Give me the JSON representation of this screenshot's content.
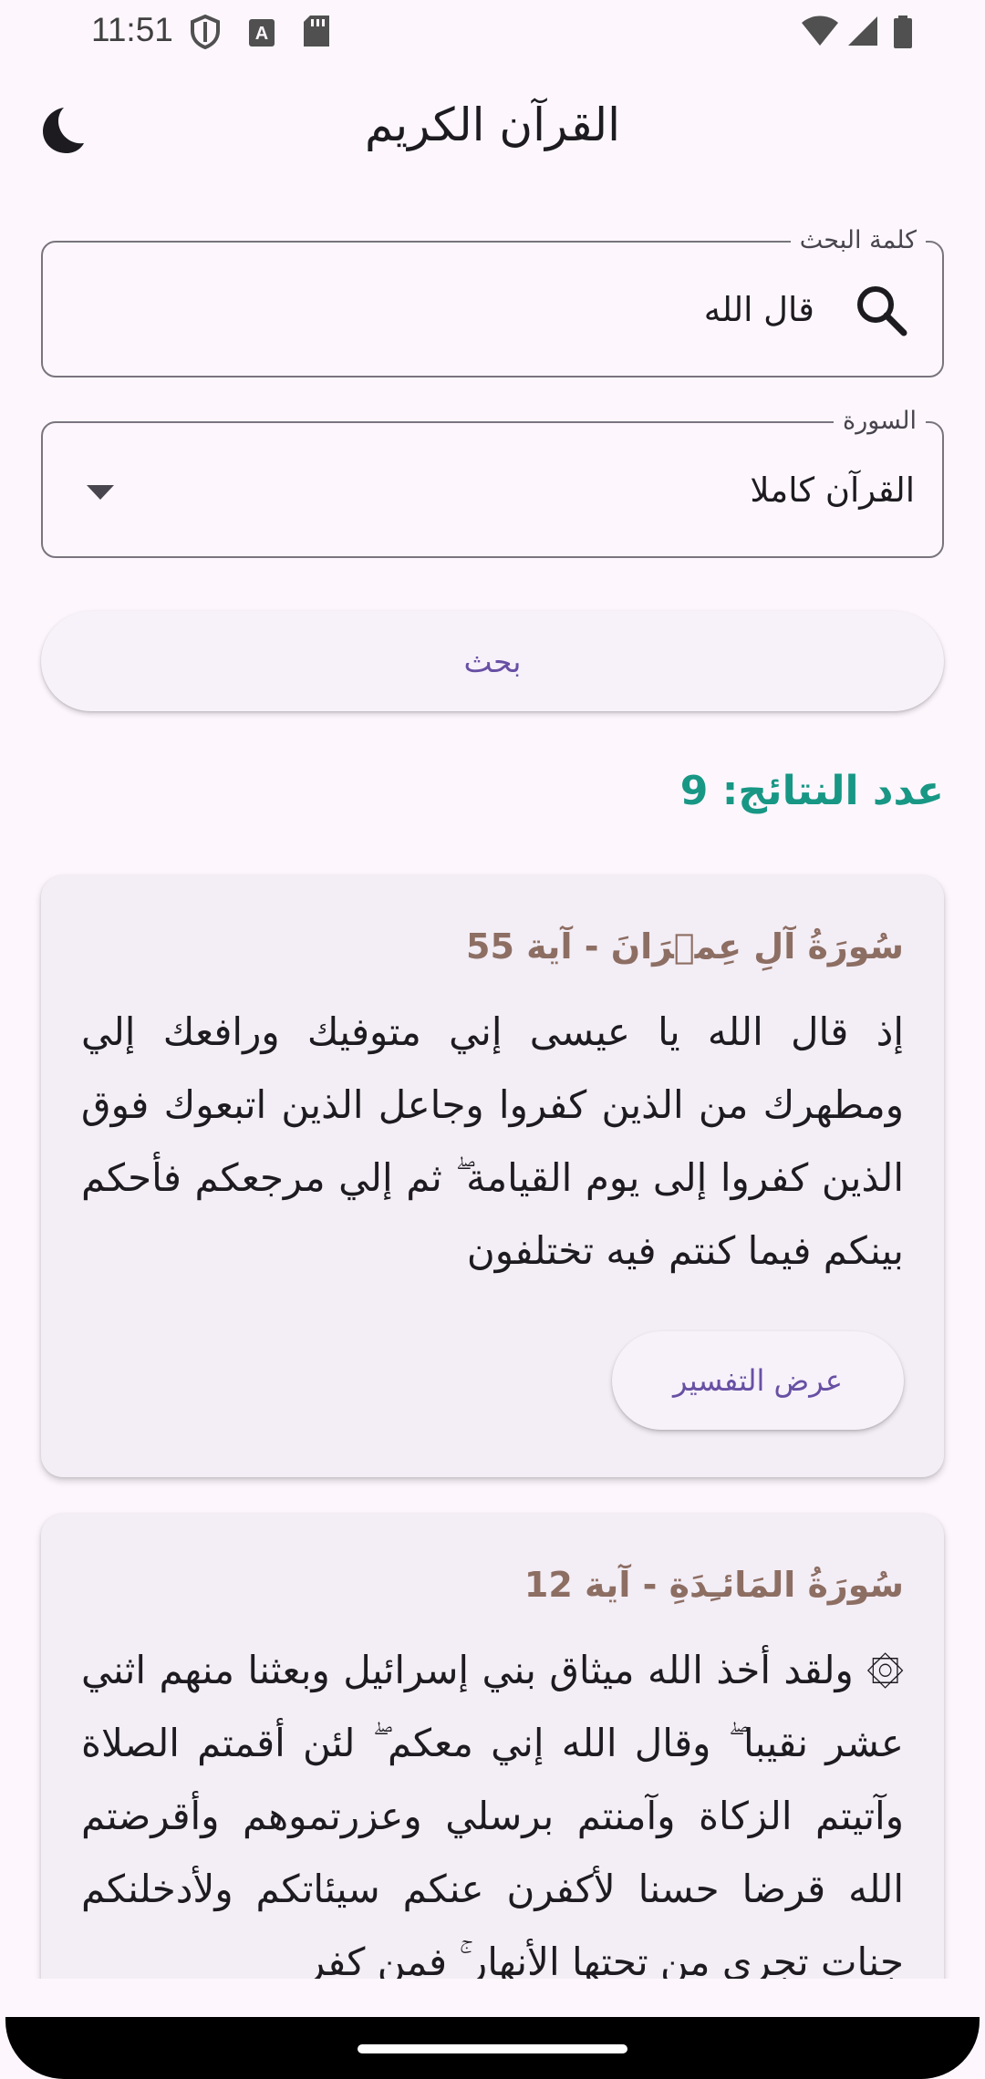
{
  "status_bar": {
    "time": "11:51"
  },
  "app_bar": {
    "title": "القرآن الكريم",
    "theme_icon": "moon-icon"
  },
  "search": {
    "label": "كلمة البحث",
    "value": "قال الله",
    "icon": "search-icon"
  },
  "surah_select": {
    "label": "السورة",
    "value": "القرآن كاملا",
    "icon": "dropdown-arrow-icon"
  },
  "search_button": {
    "label": "بحث"
  },
  "results": {
    "count_text": "عدد النتائج: 9",
    "items": [
      {
        "title": "سُورَةُ آلِ عِمۡرَانَ - آية 55",
        "text": "إذ قال الله يا عيسى إني متوفيك ورافعك إلي ومطهرك من الذين كفروا وجاعل الذين اتبعوك فوق الذين كفروا إلى يوم القيامة ۖ ثم إلي مرجعكم فأحكم بينكم فيما كنتم فيه تختلفون",
        "button_label": "عرض التفسير"
      },
      {
        "title": "سُورَةُ المَائـِدَةِ - آية 12",
        "text": "۞ ولقد أخذ الله ميثاق بني إسرائيل وبعثنا منهم اثني عشر نقيبا ۖ وقال الله إني معكم ۖ لئن أقمتم الصلاة وآتيتم الزكاة وآمنتم برسلي وعزرتموهم وأقرضتم الله قرضا حسنا لأكفرن عنكم سيئاتكم ولأدخلنكم جنات تجري من تحتها الأنهار ۚ فمن كفر"
      }
    ]
  },
  "colors": {
    "background": "#fdf7fd",
    "accent": "#6750a4",
    "count": "#189785",
    "card_title": "#8d6e63",
    "card_bg": "#f3edf5"
  }
}
